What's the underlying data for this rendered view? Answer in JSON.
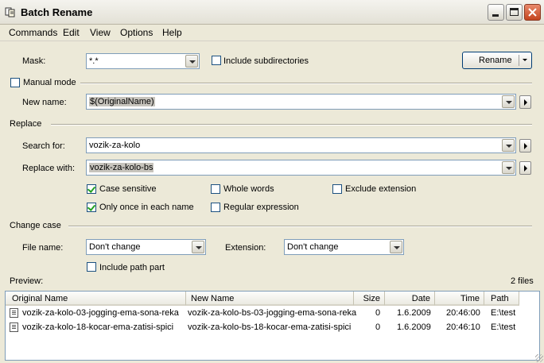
{
  "window": {
    "title": "Batch Rename"
  },
  "menu": [
    {
      "label": "Commands"
    },
    {
      "label": "Edit"
    },
    {
      "label": "View"
    },
    {
      "label": "Options"
    },
    {
      "label": "Help"
    }
  ],
  "mask": {
    "label": "Mask:",
    "value": "*.*",
    "include_subdirs_label": "Include subdirectories",
    "include_subdirs_checked": false
  },
  "rename_button": {
    "label": "Rename"
  },
  "manual_mode": {
    "label": "Manual mode",
    "checked": false
  },
  "new_name": {
    "label": "New name:",
    "value": "$(OriginalName)"
  },
  "replace": {
    "section_label": "Replace",
    "search_label": "Search for:",
    "search_value": "vozik-za-kolo",
    "replace_label": "Replace with:",
    "replace_value": "vozik-za-kolo-bs",
    "case_sensitive": {
      "label": "Case sensitive",
      "checked": true
    },
    "whole_words": {
      "label": "Whole words",
      "checked": false
    },
    "exclude_extension": {
      "label": "Exclude extension",
      "checked": false
    },
    "only_once": {
      "label": "Only once in each name",
      "checked": true
    },
    "regex": {
      "label": "Regular expression",
      "checked": false
    }
  },
  "change_case": {
    "section_label": "Change case",
    "file_name_label": "File name:",
    "file_name_value": "Don't change",
    "extension_label": "Extension:",
    "extension_value": "Don't change",
    "include_path": {
      "label": "Include path part",
      "checked": false
    }
  },
  "preview": {
    "label": "Preview:",
    "count": "2 files",
    "columns": [
      "Original Name",
      "New Name",
      "Size",
      "Date",
      "Time",
      "Path"
    ],
    "rows": [
      {
        "original": "vozik-za-kolo-03-jogging-ema-sona-reka",
        "new": "vozik-za-kolo-bs-03-jogging-ema-sona-reka",
        "size": "0",
        "date": "1.6.2009",
        "time": "20:46:00",
        "path": "E:\\test"
      },
      {
        "original": "vozik-za-kolo-18-kocar-ema-zatisi-spici",
        "new": "vozik-za-kolo-bs-18-kocar-ema-zatisi-spici",
        "size": "0",
        "date": "1.6.2009",
        "time": "20:46:10",
        "path": "E:\\test"
      }
    ]
  },
  "icons": {
    "app": "batch-rename-icon",
    "minimize": "minimize-icon",
    "maximize": "maximize-icon",
    "close": "close-icon"
  },
  "colors": {
    "window_bg": "#ece9d8",
    "close_button": "#c4441e",
    "check_green": "#21a121",
    "field_border": "#7f9db9"
  }
}
